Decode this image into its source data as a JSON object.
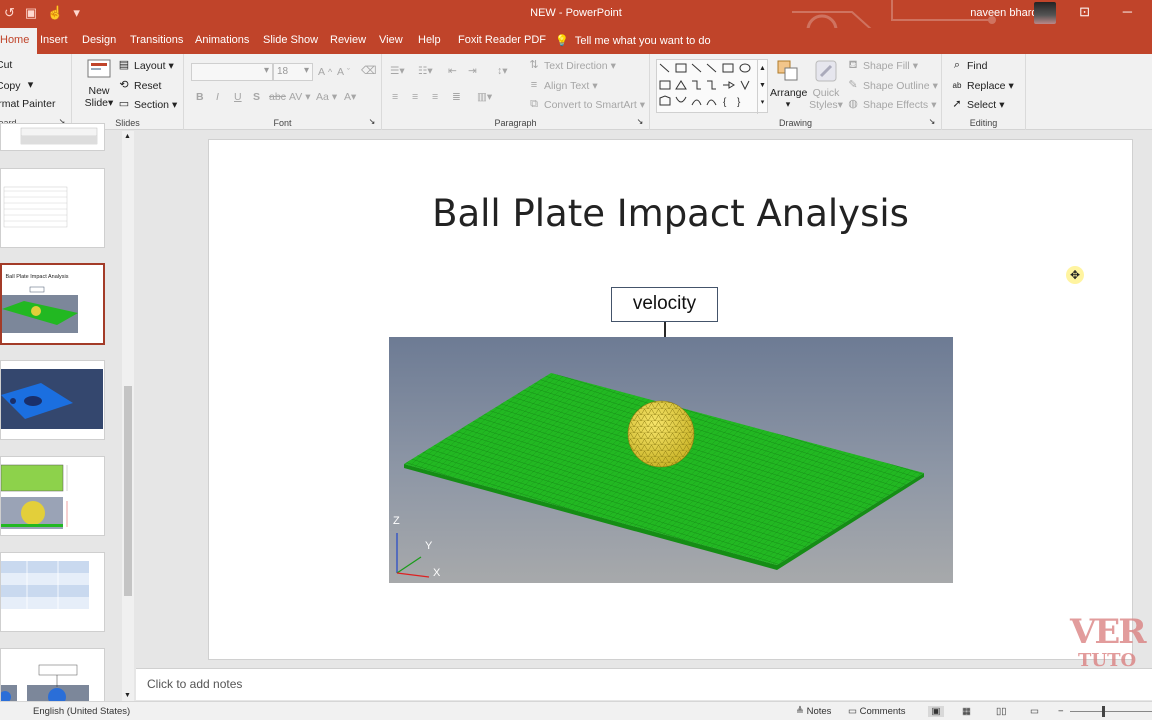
{
  "window": {
    "title": "NEW  -  PowerPoint",
    "user": "naveen bhardwaj"
  },
  "tabs": [
    "Home",
    "Insert",
    "Design",
    "Transitions",
    "Animations",
    "Slide Show",
    "Review",
    "View",
    "Help",
    "Foxit Reader PDF"
  ],
  "tell_me": "Tell me what you want to do",
  "ribbon": {
    "clipboard": {
      "cut": "Cut",
      "copy": "Copy",
      "format_painter": "Format Painter",
      "label": "Clipboard"
    },
    "slides": {
      "new_slide_line1": "New",
      "new_slide_line2": "Slide",
      "layout": "Layout",
      "reset": "Reset",
      "section": "Section",
      "label": "Slides"
    },
    "font": {
      "size_value": "18",
      "label": "Font",
      "bold": "B",
      "italic": "I",
      "underline": "U",
      "shadow": "S",
      "strike": "abc",
      "spacing": "AV",
      "case": "Aa"
    },
    "paragraph": {
      "text_direction": "Text Direction",
      "align_text": "Align Text",
      "convert_smartart": "Convert to SmartArt",
      "label": "Paragraph"
    },
    "drawing": {
      "arrange": "Arrange",
      "quick_styles_line1": "Quick",
      "quick_styles_line2": "Styles",
      "shape_fill": "Shape Fill",
      "shape_outline": "Shape Outline",
      "shape_effects": "Shape Effects",
      "label": "Drawing"
    },
    "editing": {
      "find": "Find",
      "replace": "Replace",
      "select": "Select",
      "label": "Editing"
    }
  },
  "thumbnails": {
    "slide_title_small": "Ball Plate Impact Analysis"
  },
  "slide": {
    "title": "Ball Plate Impact Analysis",
    "callout": "velocity",
    "axes": {
      "z": "Z",
      "y": "Y",
      "x": "X"
    }
  },
  "notes_placeholder": "Click to add notes",
  "status": {
    "language": "English (United States)",
    "notes": "Notes",
    "comments": "Comments"
  },
  "watermark": {
    "line1": "VER",
    "line2": "TUTO"
  },
  "colors": {
    "accent": "#c0442a",
    "plate": "#22b822",
    "ball": "#e3cf3a"
  }
}
